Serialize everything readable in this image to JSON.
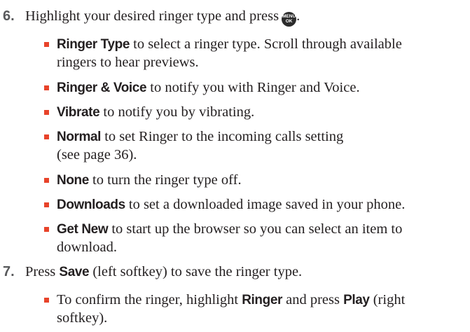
{
  "step6": {
    "number": "6.",
    "text": "Highlight your desired ringer type and press",
    "key_top": "MENU",
    "key_bottom": "OK",
    "period": "."
  },
  "options": [
    {
      "term": "Ringer Type",
      "text1": " to select a ringer type. Scroll through available",
      "text2": "ringers to hear previews."
    },
    {
      "term": "Ringer & Voice",
      "text1": " to notify you with Ringer and Voice."
    },
    {
      "term": "Vibrate",
      "text1": " to notify you by vibrating."
    },
    {
      "term": "Normal",
      "text1": " to set Ringer to the incoming calls setting",
      "text2": "(see page 36)."
    },
    {
      "term": "None",
      "text1": " to turn the ringer type off."
    },
    {
      "term": "Downloads",
      "text1": " to set a downloaded image saved in your phone."
    },
    {
      "term": "Get New",
      "text1": " to start up the browser so you can select an item to",
      "text2": "download."
    }
  ],
  "step7": {
    "number": "7.",
    "pre": "Press ",
    "save": "Save",
    "post": " (left softkey) to save the ringer type."
  },
  "confirm": {
    "pre": "To confirm the ringer, highlight ",
    "ringer": "Ringer",
    "mid": " and press ",
    "play": "Play",
    "post": " (right",
    "line2": "softkey)."
  }
}
